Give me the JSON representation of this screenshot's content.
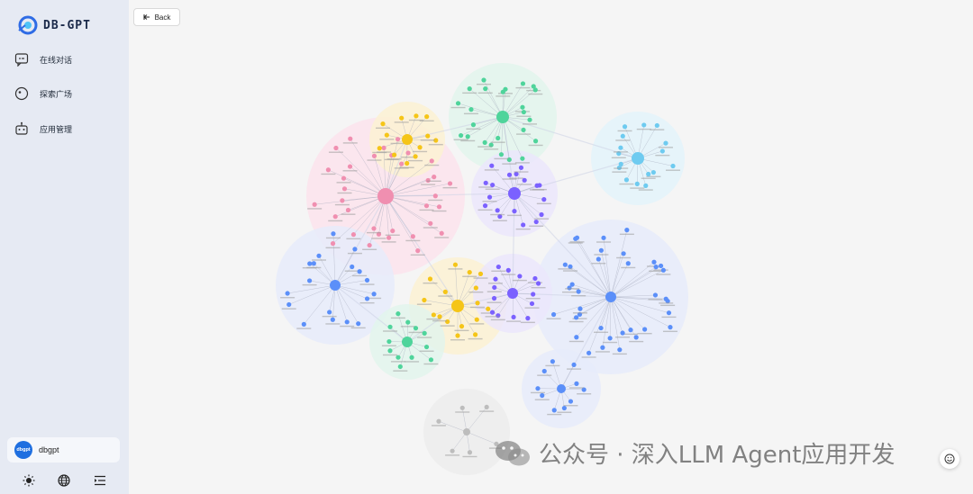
{
  "app": {
    "logo_text": "DB-GPT"
  },
  "sidebar": {
    "items": [
      {
        "label": "在线对话",
        "icon": "chat-icon"
      },
      {
        "label": "探索广场",
        "icon": "explore-icon"
      },
      {
        "label": "应用管理",
        "icon": "robot-icon"
      }
    ],
    "user": {
      "avatar_text": "dbgpt",
      "name": "dbgpt"
    },
    "bottom_icons": [
      "sun-icon",
      "globe-icon",
      "menu-collapse-icon"
    ]
  },
  "toolbar": {
    "back_label": "Back"
  },
  "watermark": {
    "text": "公众号 · 深入LLM Agent应用开发"
  },
  "graph": {
    "type": "knowledge-graph",
    "clusters": [
      {
        "color": "#f08fb0",
        "hull": "#fbe3ec",
        "leaves": 34
      },
      {
        "color": "#4fd49b",
        "hull": "#e2f5ec",
        "leaves": 24
      },
      {
        "color": "#6ecbf0",
        "hull": "#e3f3fa",
        "leaves": 16
      },
      {
        "color": "#f5c518",
        "hull": "#fbf1d2",
        "leaves": 12
      },
      {
        "color": "#7b61ff",
        "hull": "#ebe6fb",
        "leaves": 18
      },
      {
        "color": "#5b8ff9",
        "hull": "#e6ebfa",
        "leaves": 36
      },
      {
        "color": "#5b8ff9",
        "hull": "#e6ebfa",
        "leaves": 18
      },
      {
        "color": "#f5c518",
        "hull": "#fbf1d2",
        "leaves": 16
      },
      {
        "color": "#4fd49b",
        "hull": "#e2f5ec",
        "leaves": 12
      },
      {
        "color": "#7b61ff",
        "hull": "#ebe6fb",
        "leaves": 14
      },
      {
        "color": "#5b8ff9",
        "hull": "#e6ebfa",
        "leaves": 10
      },
      {
        "color": "#bdbdbd",
        "hull": "#ececec",
        "leaves": 6
      }
    ]
  }
}
